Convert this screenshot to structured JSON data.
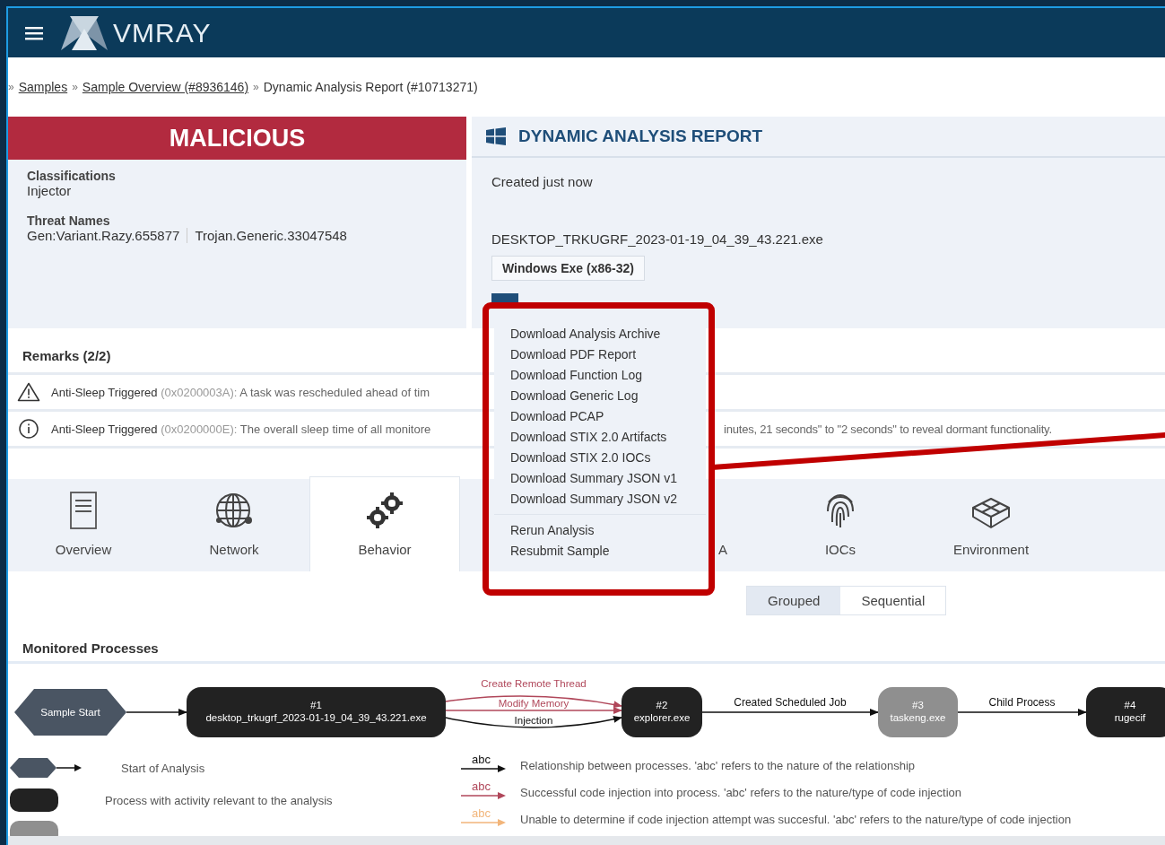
{
  "header": {
    "logo": "VMRAY"
  },
  "breadcrumb": [
    {
      "separator": "»",
      "text": "Samples",
      "link": true
    },
    {
      "separator": "»",
      "text": "Sample Overview (#8936146)",
      "link": true
    },
    {
      "separator": "»",
      "text": "Dynamic Analysis Report (#10713271)",
      "link": false
    }
  ],
  "verdict": {
    "label": "MALICIOUS",
    "classifications_label": "Classifications",
    "classifications": "Injector",
    "threat_names_label": "Threat Names",
    "threat_names": [
      "Gen:Variant.Razy.655877",
      "Trojan.Generic.33047548"
    ]
  },
  "report": {
    "title": "DYNAMIC ANALYSIS REPORT",
    "created": "Created just now",
    "filename": "DESKTOP_TRKUGRF_2023-01-19_04_39_43.221.exe",
    "file_type": "Windows Exe (x86-32)"
  },
  "menu": {
    "groups": [
      [
        "Download Analysis Archive",
        "Download PDF Report",
        "Download Function Log",
        "Download Generic Log",
        "Download PCAP",
        "Download STIX 2.0 Artifacts",
        "Download STIX 2.0 IOCs",
        "Download Summary JSON v1",
        "Download Summary JSON v2"
      ],
      [
        "Rerun Analysis",
        "Resubmit Sample"
      ]
    ]
  },
  "remarks": {
    "title": "Remarks (2/2)",
    "items": [
      {
        "kind": "warning",
        "name": "Anti-Sleep Triggered",
        "code": "(0x0200003A):",
        "fragments": [
          "A task was rescheduled ahead of tim"
        ]
      },
      {
        "kind": "info",
        "name": "Anti-Sleep Triggered",
        "code": "(0x0200000E):",
        "fragments": [
          "The overall sleep time of all monitore",
          "inutes, 21 seconds\" to \"2 seconds\" to reveal dormant functionality."
        ]
      }
    ]
  },
  "tabs": [
    {
      "kind": "document",
      "label": "Overview",
      "selected": false
    },
    {
      "kind": "globe",
      "label": "Network",
      "selected": false
    },
    {
      "kind": "gears",
      "label": "Behavior",
      "selected": true
    },
    {
      "kind": "covered",
      "label": "A",
      "selected": false
    },
    {
      "kind": "fingerprint",
      "label": "IOCs",
      "selected": false
    },
    {
      "kind": "cube",
      "label": "Environment",
      "selected": false
    }
  ],
  "view_toggle": [
    {
      "label": "Grouped",
      "selected": true
    },
    {
      "label": "Sequential",
      "selected": false
    }
  ],
  "processes": {
    "title": "Monitored Processes",
    "nodes": [
      {
        "kind": "start",
        "lines": [
          "Sample Start"
        ]
      },
      {
        "kind": "relevant",
        "lines": [
          "#1",
          "desktop_trkugrf_2023-01-19_04_39_43.221.exe"
        ]
      },
      {
        "kind": "relevant",
        "lines": [
          "#2",
          "explorer.exe"
        ]
      },
      {
        "kind": "irrelevant",
        "lines": [
          "#3",
          "taskeng.exe"
        ]
      },
      {
        "kind": "relevant",
        "lines": [
          "#4",
          "rugecif"
        ]
      }
    ],
    "edges": [
      {
        "kind": "relation"
      },
      {
        "labels": [
          {
            "kind": "injection",
            "text": "Create Remote Thread"
          },
          {
            "kind": "injection",
            "text": "Modify Memory"
          },
          {
            "kind": "relation",
            "text": "Injection"
          }
        ]
      },
      {
        "labels": [
          {
            "kind": "relation",
            "text": "Created Scheduled Job"
          }
        ]
      },
      {
        "labels": [
          {
            "kind": "relation",
            "text": "Child Process"
          }
        ]
      }
    ]
  },
  "legend": {
    "nodes": [
      {
        "kind": "start",
        "text": "Start of Analysis"
      },
      {
        "kind": "relevant",
        "text": "Process with activity relevant to the analysis"
      },
      {
        "kind": "irrelevant"
      }
    ],
    "edges": [
      {
        "kind": "relation",
        "sample": "abc",
        "text": "Relationship between processes. 'abc' refers to the nature of the relationship"
      },
      {
        "kind": "injection",
        "sample": "abc",
        "text": "Successful code injection into process. 'abc' refers to the nature/type of code injection"
      },
      {
        "kind": "unknown",
        "sample": "abc",
        "text": "Unable to determine if code injection attempt was succesful. 'abc' refers to the nature/type of code injection"
      }
    ]
  }
}
